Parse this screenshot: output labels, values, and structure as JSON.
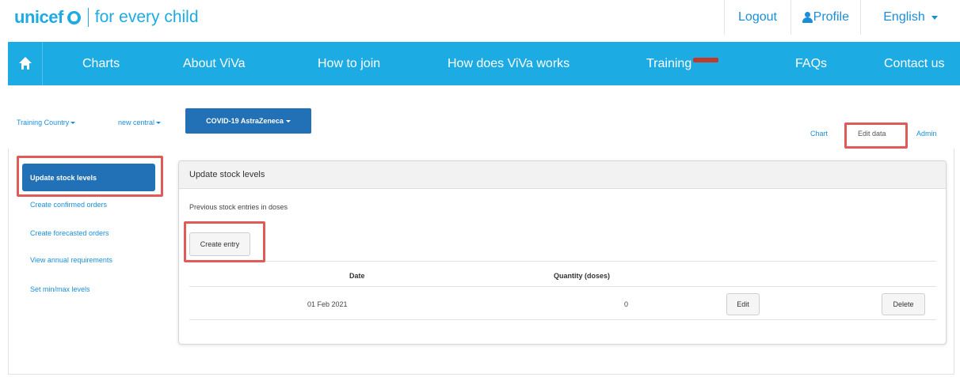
{
  "brand": {
    "name": "unicef",
    "tagline": "for every child",
    "color": "#1cabe2"
  },
  "top_links": {
    "logout": "Logout",
    "profile": "Profile",
    "language": "English"
  },
  "nav": {
    "items": [
      {
        "label": "Charts"
      },
      {
        "label": "About ViVa"
      },
      {
        "label": "How to join"
      },
      {
        "label": "How does ViVa works"
      },
      {
        "label": "Training"
      },
      {
        "label": "FAQs"
      },
      {
        "label": "Contact us"
      }
    ],
    "new_badge_color": "#c0392b"
  },
  "selectors": {
    "country": "Training Country",
    "store": "new central",
    "vaccine": "COVID-19 AstraZeneca"
  },
  "view_tabs": {
    "chart": "Chart",
    "edit_data": "Edit data",
    "admin": "Admin"
  },
  "sidebar": {
    "active": "Update stock levels",
    "links": [
      "Create confirmed orders",
      "Create forecasted orders",
      "View annual requirements",
      "Set min/max levels"
    ]
  },
  "panel": {
    "title": "Update stock levels",
    "subtitle": "Previous stock entries in doses",
    "create_button": "Create entry",
    "columns": {
      "date": "Date",
      "quantity": "Quantity (doses)"
    },
    "rows": [
      {
        "date": "01 Feb 2021",
        "quantity": "0",
        "edit": "Edit",
        "delete": "Delete"
      }
    ]
  },
  "colors": {
    "accent_blue": "#2270b5",
    "highlight_red": "#e05a57"
  }
}
